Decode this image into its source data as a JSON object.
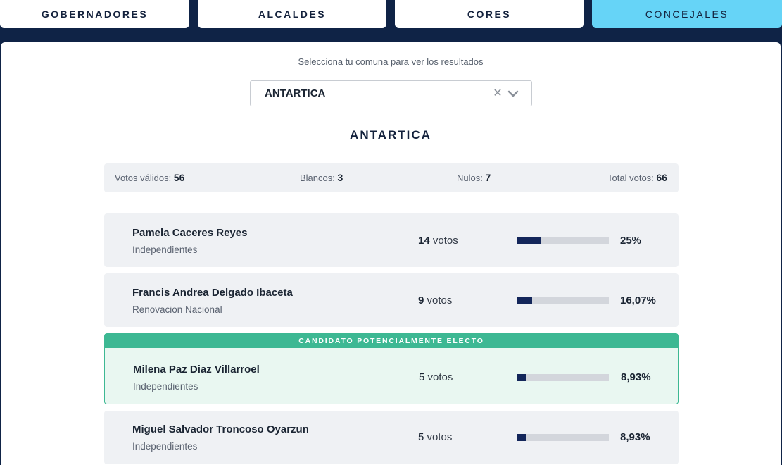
{
  "tabs": [
    {
      "label": "GOBERNADORES",
      "active": false
    },
    {
      "label": "ALCALDES",
      "active": false
    },
    {
      "label": "CORES",
      "active": false
    },
    {
      "label": "CONCEJALES",
      "active": true
    }
  ],
  "prompt": "Selecciona tu comuna para ver los resultados",
  "select": {
    "value": "ANTARTICA",
    "clear_icon": "clear-icon",
    "dropdown_icon": "chevron-down-icon"
  },
  "commune_title": "ANTARTICA",
  "summary": {
    "valid_label": "Votos válidos:",
    "valid_value": "56",
    "blank_label": "Blancos:",
    "blank_value": "3",
    "null_label": "Nulos:",
    "null_value": "7",
    "total_label": "Total votos:",
    "total_value": "66"
  },
  "elected_banner": "CANDIDATO POTENCIALMENTE ELECTO",
  "votes_unit": "votos",
  "candidates": [
    {
      "name": "Pamela Caceres Reyes",
      "party": "Independientes",
      "votes": "14",
      "percent": "25%",
      "share": 0.25,
      "elected": false
    },
    {
      "name": "Francis Andrea Delgado Ibaceta",
      "party": "Renovacion Nacional",
      "votes": "9",
      "percent": "16,07%",
      "share": 0.1607,
      "elected": false
    },
    {
      "name": "Milena Paz Diaz Villarroel",
      "party": "Independientes",
      "votes": "5",
      "percent": "8,93%",
      "share": 0.0893,
      "elected": true
    },
    {
      "name": "Miguel Salvador Troncoso Oyarzun",
      "party": "Independientes",
      "votes": "5",
      "percent": "8,93%",
      "share": 0.0893,
      "elected": false
    }
  ],
  "colors": {
    "accent": "#66d4f7",
    "navy": "#0f2346",
    "elected": "#3db893",
    "bar": "#13265a"
  }
}
